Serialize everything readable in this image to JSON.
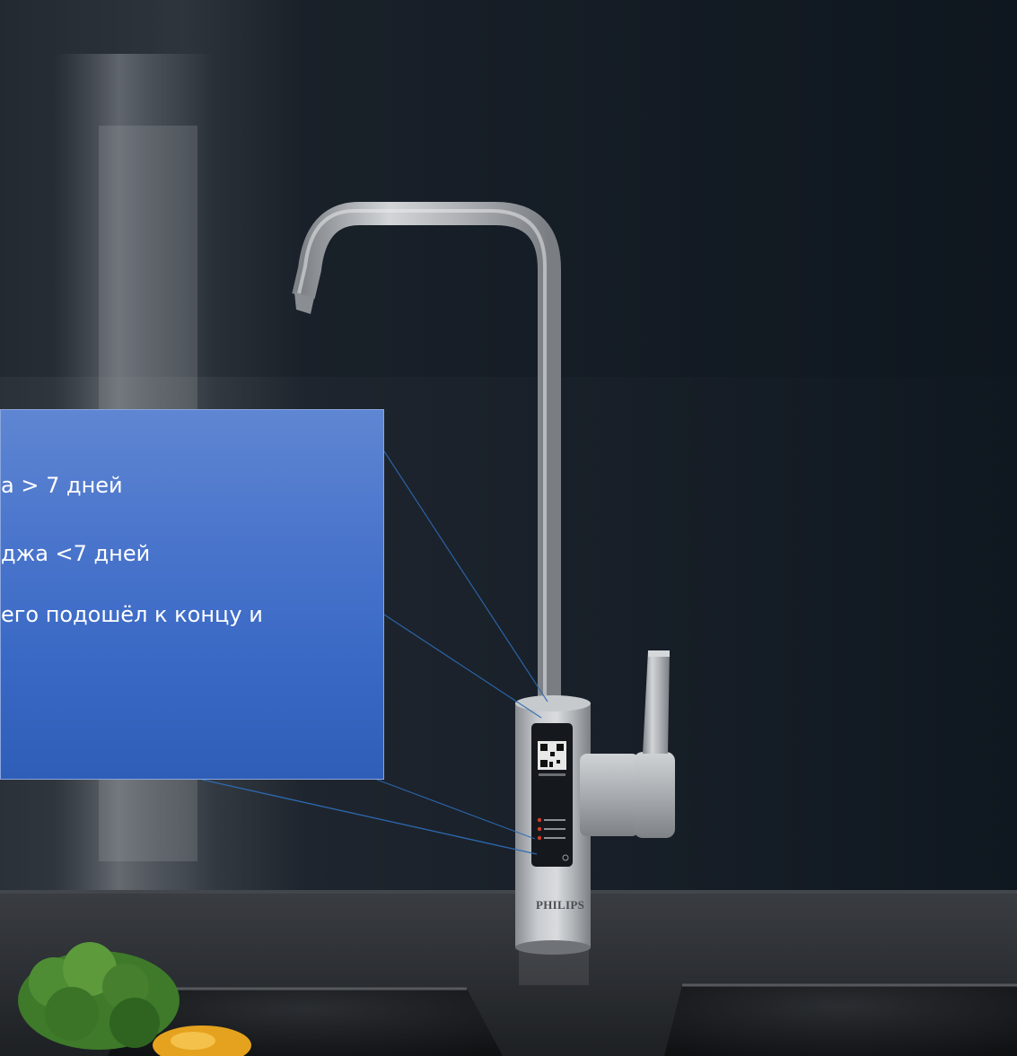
{
  "callout": {
    "lines": [
      "а > 7 дней",
      "джа <7 дней",
      "его подошёл к концу и"
    ]
  },
  "faucet": {
    "brand": "PHILIPS"
  },
  "colors": {
    "background_dark": "#121a24",
    "callout_blue": "#3a69c6",
    "steel": "#b9bcc0",
    "indicator_red": "#d23a2a"
  }
}
